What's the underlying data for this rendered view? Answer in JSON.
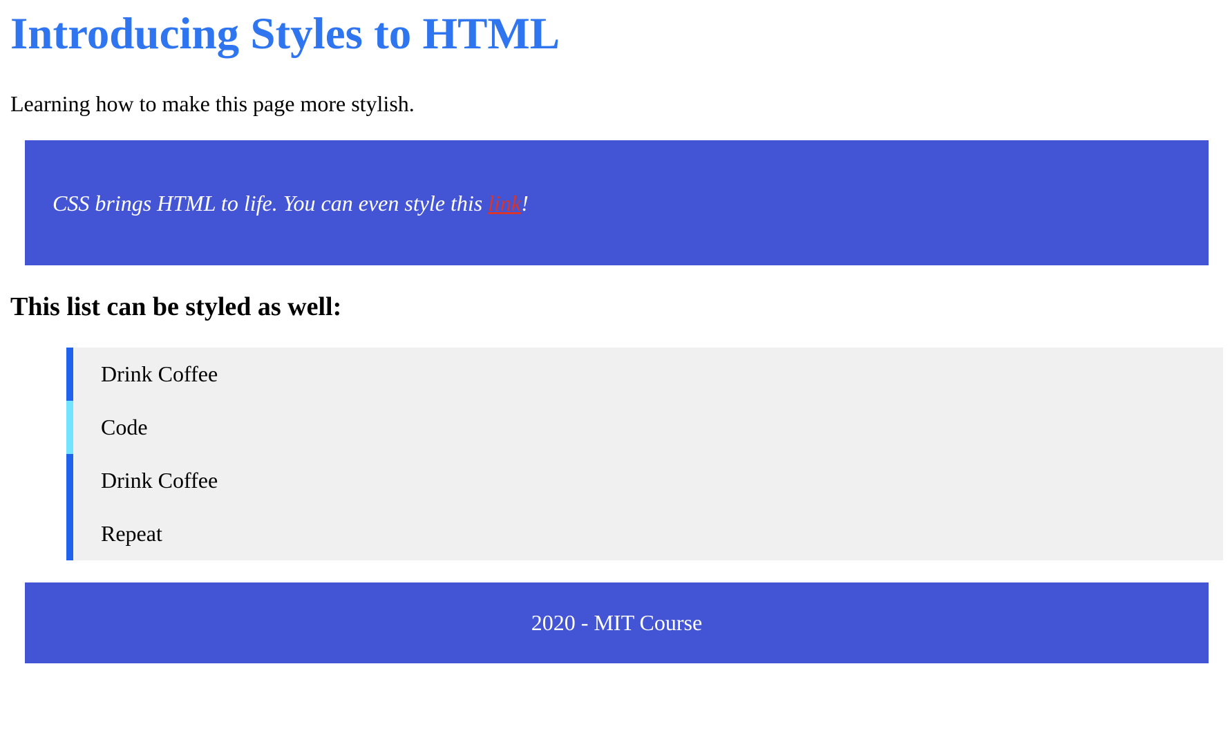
{
  "header": {
    "title": "Introducing Styles to HTML",
    "subtitle": "Learning how to make this page more stylish."
  },
  "banner": {
    "text_before": "CSS brings HTML to life. You can even style this ",
    "link_text": "link",
    "text_after": "!"
  },
  "list": {
    "heading": "This list can be styled as well:",
    "items": [
      {
        "label": "Drink Coffee"
      },
      {
        "label": "Code"
      },
      {
        "label": "Drink Coffee"
      },
      {
        "label": "Repeat"
      }
    ]
  },
  "footer": {
    "text": "2020 - MIT Course"
  },
  "colors": {
    "title": "#2f75f0",
    "banner_bg": "#4354d5",
    "banner_text": "#ffffff",
    "link": "#d8352c",
    "list_bg": "#f0f0f0",
    "list_accent": "#2162ec",
    "list_accent_alt": "#72e4fd",
    "footer_bg": "#4354d5",
    "footer_text": "#ffffff"
  }
}
